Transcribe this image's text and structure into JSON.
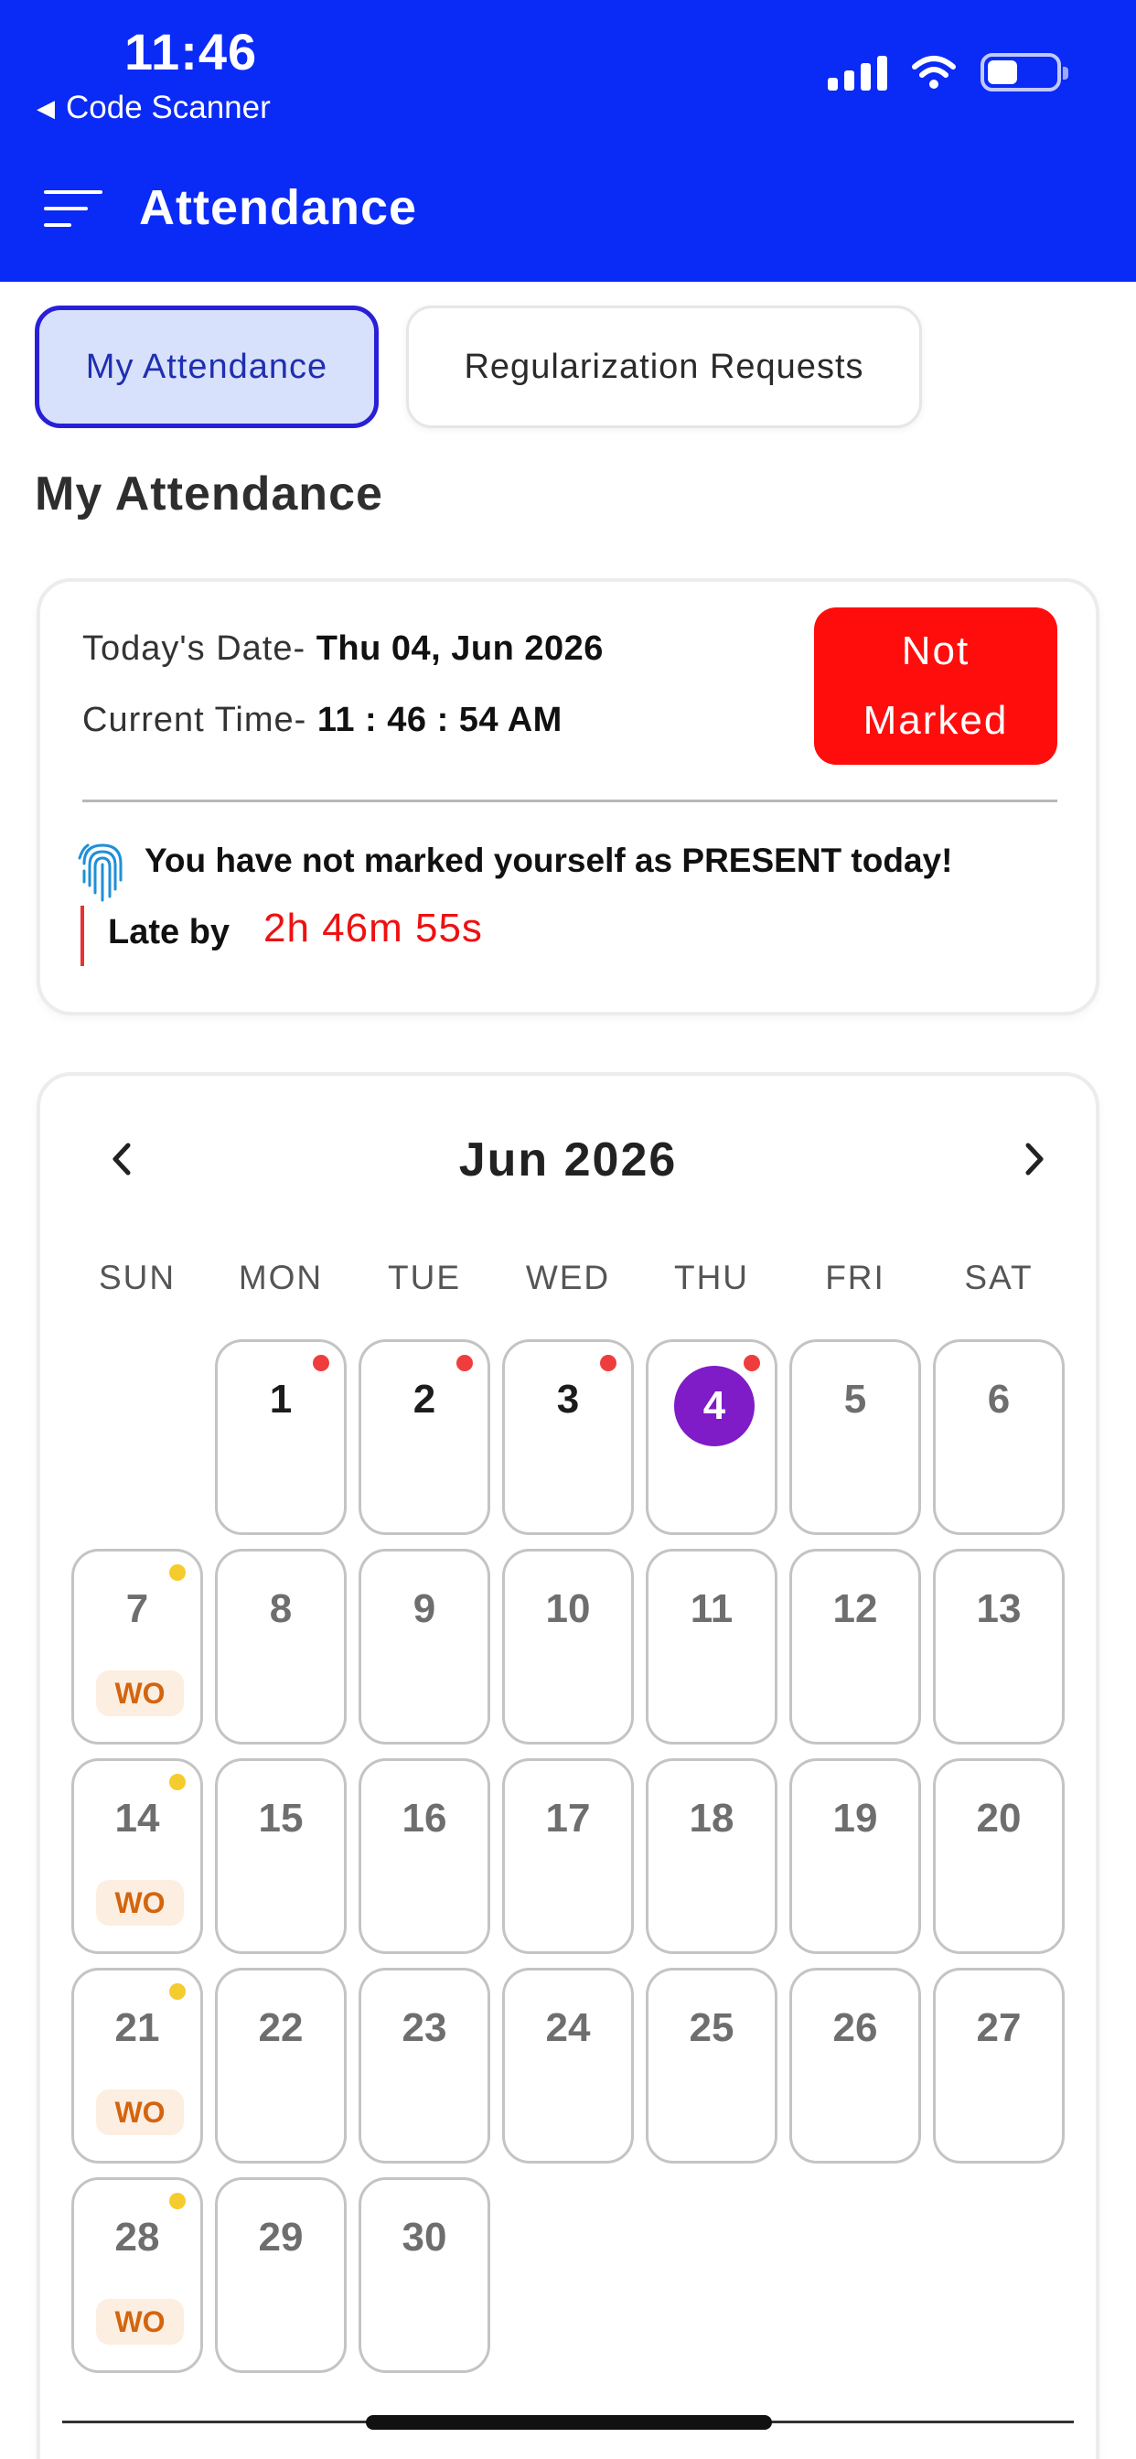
{
  "status_bar": {
    "time": "11:46",
    "back_app": "Code Scanner",
    "back_icon": "back-triangle-icon",
    "icons": [
      "signal-icon",
      "wifi-icon",
      "battery-icon"
    ]
  },
  "header": {
    "title": "Attendance",
    "menu_icon": "menu-icon",
    "background_color": "#0a2af5"
  },
  "tabs": [
    {
      "label": "My Attendance",
      "active": true
    },
    {
      "label": "Regularization Requests",
      "active": false
    }
  ],
  "section_title": "My Attendance",
  "status_card": {
    "date_label": "Today's Date- ",
    "date_value": "Thu 04, Jun 2026",
    "time_label": "Current Time- ",
    "time_value": "11 : 46 : 54 AM",
    "status_line1": "Not",
    "status_line2": "Marked",
    "status_color": "#ff0d0d",
    "warning": "You have not marked yourself as PRESENT today!",
    "late_label": "Late by",
    "late_value": "2h 46m 55s"
  },
  "calendar": {
    "month": "Jun 2026",
    "weekdays": [
      "SUN",
      "MON",
      "TUE",
      "WED",
      "THU",
      "FRI",
      "SAT"
    ],
    "weekoff_label": "WO",
    "today": 4,
    "days": [
      {
        "day": "1",
        "dot": "red"
      },
      {
        "day": "2",
        "dot": "red"
      },
      {
        "day": "3",
        "dot": "red"
      },
      {
        "day": "4",
        "dot": "red",
        "today": true
      },
      {
        "day": "5"
      },
      {
        "day": "6"
      },
      {
        "day": "7",
        "dot": "yellow",
        "wo": true
      },
      {
        "day": "8"
      },
      {
        "day": "9"
      },
      {
        "day": "10"
      },
      {
        "day": "11"
      },
      {
        "day": "12"
      },
      {
        "day": "13"
      },
      {
        "day": "14",
        "dot": "yellow",
        "wo": true
      },
      {
        "day": "15"
      },
      {
        "day": "16"
      },
      {
        "day": "17"
      },
      {
        "day": "18"
      },
      {
        "day": "19"
      },
      {
        "day": "20"
      },
      {
        "day": "21",
        "dot": "yellow",
        "wo": true
      },
      {
        "day": "22"
      },
      {
        "day": "23"
      },
      {
        "day": "24"
      },
      {
        "day": "25"
      },
      {
        "day": "26"
      },
      {
        "day": "27"
      },
      {
        "day": "28",
        "dot": "yellow",
        "wo": true
      },
      {
        "day": "29"
      },
      {
        "day": "30"
      }
    ]
  }
}
